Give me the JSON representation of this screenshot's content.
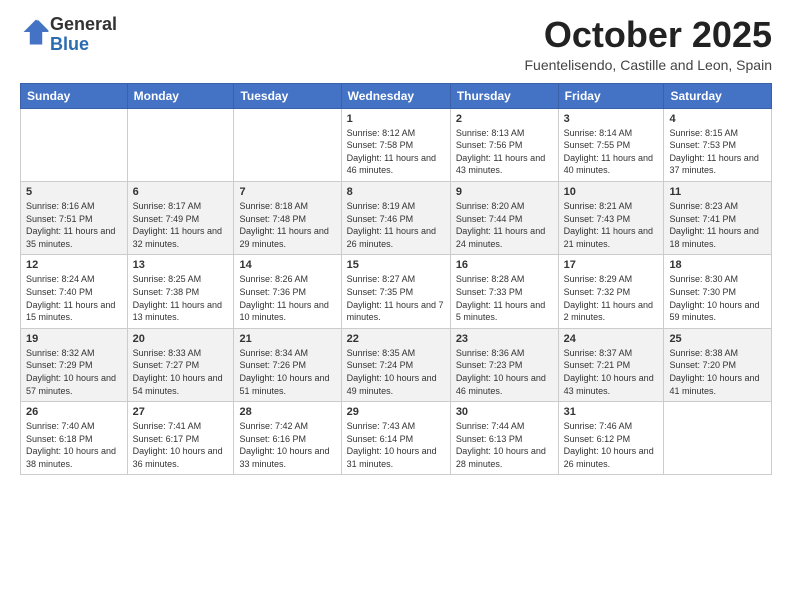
{
  "header": {
    "logo_general": "General",
    "logo_blue": "Blue",
    "month_title": "October 2025",
    "subtitle": "Fuentelisendo, Castille and Leon, Spain"
  },
  "calendar": {
    "days_of_week": [
      "Sunday",
      "Monday",
      "Tuesday",
      "Wednesday",
      "Thursday",
      "Friday",
      "Saturday"
    ],
    "weeks": [
      [
        {
          "day": "",
          "info": ""
        },
        {
          "day": "",
          "info": ""
        },
        {
          "day": "",
          "info": ""
        },
        {
          "day": "1",
          "info": "Sunrise: 8:12 AM\nSunset: 7:58 PM\nDaylight: 11 hours and 46 minutes."
        },
        {
          "day": "2",
          "info": "Sunrise: 8:13 AM\nSunset: 7:56 PM\nDaylight: 11 hours and 43 minutes."
        },
        {
          "day": "3",
          "info": "Sunrise: 8:14 AM\nSunset: 7:55 PM\nDaylight: 11 hours and 40 minutes."
        },
        {
          "day": "4",
          "info": "Sunrise: 8:15 AM\nSunset: 7:53 PM\nDaylight: 11 hours and 37 minutes."
        }
      ],
      [
        {
          "day": "5",
          "info": "Sunrise: 8:16 AM\nSunset: 7:51 PM\nDaylight: 11 hours and 35 minutes."
        },
        {
          "day": "6",
          "info": "Sunrise: 8:17 AM\nSunset: 7:49 PM\nDaylight: 11 hours and 32 minutes."
        },
        {
          "day": "7",
          "info": "Sunrise: 8:18 AM\nSunset: 7:48 PM\nDaylight: 11 hours and 29 minutes."
        },
        {
          "day": "8",
          "info": "Sunrise: 8:19 AM\nSunset: 7:46 PM\nDaylight: 11 hours and 26 minutes."
        },
        {
          "day": "9",
          "info": "Sunrise: 8:20 AM\nSunset: 7:44 PM\nDaylight: 11 hours and 24 minutes."
        },
        {
          "day": "10",
          "info": "Sunrise: 8:21 AM\nSunset: 7:43 PM\nDaylight: 11 hours and 21 minutes."
        },
        {
          "day": "11",
          "info": "Sunrise: 8:23 AM\nSunset: 7:41 PM\nDaylight: 11 hours and 18 minutes."
        }
      ],
      [
        {
          "day": "12",
          "info": "Sunrise: 8:24 AM\nSunset: 7:40 PM\nDaylight: 11 hours and 15 minutes."
        },
        {
          "day": "13",
          "info": "Sunrise: 8:25 AM\nSunset: 7:38 PM\nDaylight: 11 hours and 13 minutes."
        },
        {
          "day": "14",
          "info": "Sunrise: 8:26 AM\nSunset: 7:36 PM\nDaylight: 11 hours and 10 minutes."
        },
        {
          "day": "15",
          "info": "Sunrise: 8:27 AM\nSunset: 7:35 PM\nDaylight: 11 hours and 7 minutes."
        },
        {
          "day": "16",
          "info": "Sunrise: 8:28 AM\nSunset: 7:33 PM\nDaylight: 11 hours and 5 minutes."
        },
        {
          "day": "17",
          "info": "Sunrise: 8:29 AM\nSunset: 7:32 PM\nDaylight: 11 hours and 2 minutes."
        },
        {
          "day": "18",
          "info": "Sunrise: 8:30 AM\nSunset: 7:30 PM\nDaylight: 10 hours and 59 minutes."
        }
      ],
      [
        {
          "day": "19",
          "info": "Sunrise: 8:32 AM\nSunset: 7:29 PM\nDaylight: 10 hours and 57 minutes."
        },
        {
          "day": "20",
          "info": "Sunrise: 8:33 AM\nSunset: 7:27 PM\nDaylight: 10 hours and 54 minutes."
        },
        {
          "day": "21",
          "info": "Sunrise: 8:34 AM\nSunset: 7:26 PM\nDaylight: 10 hours and 51 minutes."
        },
        {
          "day": "22",
          "info": "Sunrise: 8:35 AM\nSunset: 7:24 PM\nDaylight: 10 hours and 49 minutes."
        },
        {
          "day": "23",
          "info": "Sunrise: 8:36 AM\nSunset: 7:23 PM\nDaylight: 10 hours and 46 minutes."
        },
        {
          "day": "24",
          "info": "Sunrise: 8:37 AM\nSunset: 7:21 PM\nDaylight: 10 hours and 43 minutes."
        },
        {
          "day": "25",
          "info": "Sunrise: 8:38 AM\nSunset: 7:20 PM\nDaylight: 10 hours and 41 minutes."
        }
      ],
      [
        {
          "day": "26",
          "info": "Sunrise: 7:40 AM\nSunset: 6:18 PM\nDaylight: 10 hours and 38 minutes."
        },
        {
          "day": "27",
          "info": "Sunrise: 7:41 AM\nSunset: 6:17 PM\nDaylight: 10 hours and 36 minutes."
        },
        {
          "day": "28",
          "info": "Sunrise: 7:42 AM\nSunset: 6:16 PM\nDaylight: 10 hours and 33 minutes."
        },
        {
          "day": "29",
          "info": "Sunrise: 7:43 AM\nSunset: 6:14 PM\nDaylight: 10 hours and 31 minutes."
        },
        {
          "day": "30",
          "info": "Sunrise: 7:44 AM\nSunset: 6:13 PM\nDaylight: 10 hours and 28 minutes."
        },
        {
          "day": "31",
          "info": "Sunrise: 7:46 AM\nSunset: 6:12 PM\nDaylight: 10 hours and 26 minutes."
        },
        {
          "day": "",
          "info": ""
        }
      ]
    ]
  }
}
